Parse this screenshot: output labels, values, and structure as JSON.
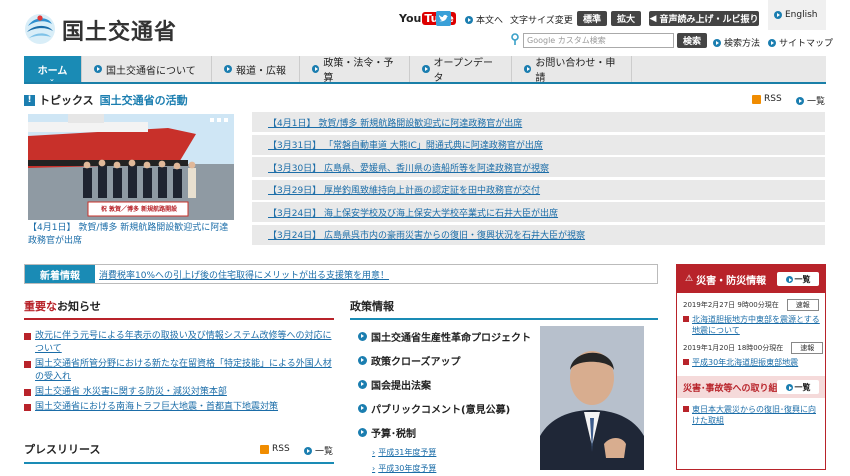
{
  "header": {
    "site_title": "国土交通省",
    "youtube_you": "You",
    "youtube_tube": "Tube",
    "honbun": "本文へ",
    "text_size_label": "文字サイズ変更",
    "size_standard": "標準",
    "size_large": "拡大",
    "speech": "音声読み上げ・ルビ振り",
    "english": "English",
    "search_placeholder": "Google カスタム検索",
    "search_button": "検索",
    "search_help": "検索方法",
    "sitemap": "サイトマップ"
  },
  "nav": {
    "items": [
      {
        "label": "ホーム"
      },
      {
        "label": "国土交通省について"
      },
      {
        "label": "報道・広報"
      },
      {
        "label": "政策・法令・予算"
      },
      {
        "label": "オープンデータ"
      },
      {
        "label": "お問い合わせ・申請"
      }
    ]
  },
  "topics": {
    "icon": "!",
    "title": "トピックス",
    "subtitle": "国土交通省の活動",
    "rss": "RSS",
    "list_link": "一覧",
    "photo_sign": "祝 敦賀／博多 新規航路開設",
    "photo_caption": "【4月1日】 敦賀/博多 新規航路開設歓迎式に阿達政務官が出席",
    "news": [
      "【4月1日】 敦賀/博多 新規航路開設歓迎式に阿達政務官が出席",
      "【3月31日】 「常磐自動車道 大熊IC」開通式典に阿達政務官が出席",
      "【3月30日】 広島県、愛媛県、香川県の造船所等を阿達政務官が視察",
      "【3月29日】 厚岸釣風致維持向上計画の認定証を田中政務官が交付",
      "【3月24日】 海上保安学校及び海上保安大学校卒業式に石井大臣が出席",
      "【3月24日】 広島県呉市内の豪雨災害からの復旧・復興状況を石井大臣が視察"
    ]
  },
  "whats_new": {
    "label": "新着情報",
    "text": "消費税率10%への引上げ後の住宅取得にメリットが出る支援策を用意！"
  },
  "notices": {
    "title_accent": "重要な",
    "title_rest": "お知らせ",
    "items": [
      "改元に伴う元号による年表示の取扱い及び情報システム改修等への対応について",
      "国土交通省所管分野における新たな在留資格「特定技能」による外国人材の受入れ",
      "国土交通省 水災害に関する防災・減災対策本部",
      "国土交通省における南海トラフ巨大地震・首都直下地震対策"
    ]
  },
  "press": {
    "title": "プレスリリース",
    "rss": "RSS",
    "list_link": "一覧"
  },
  "policy": {
    "title": "政策情報",
    "items": [
      "国土交通省生産性革命プロジェクト",
      "政策クローズアップ",
      "国会提出法案",
      "パブリックコメント(意見公募)",
      "予算･税制"
    ],
    "sub_items": [
      "平成31年度予算",
      "平成30年度予算"
    ]
  },
  "disaster": {
    "title": "災害・防災情報",
    "list_link": "一覧",
    "entries": [
      {
        "date": "2019年2月27日 9時00分現在",
        "tag": "速報",
        "link": "北海道胆振地方中東部を震源とする地震について"
      },
      {
        "date": "2019年1月20日 18時00分現在",
        "tag": "速報",
        "link": "平成30年北海道胆振東部地震"
      }
    ],
    "sub_title": "災害･事故等への取り組み",
    "sub_list_link": "一覧",
    "sub_items": [
      "東日本大震災からの復旧･復興に向けた取組"
    ]
  },
  "colors": {
    "nav_accent": "#1a8bb5",
    "link": "#1b6da8",
    "disaster_red": "#b8232a"
  }
}
